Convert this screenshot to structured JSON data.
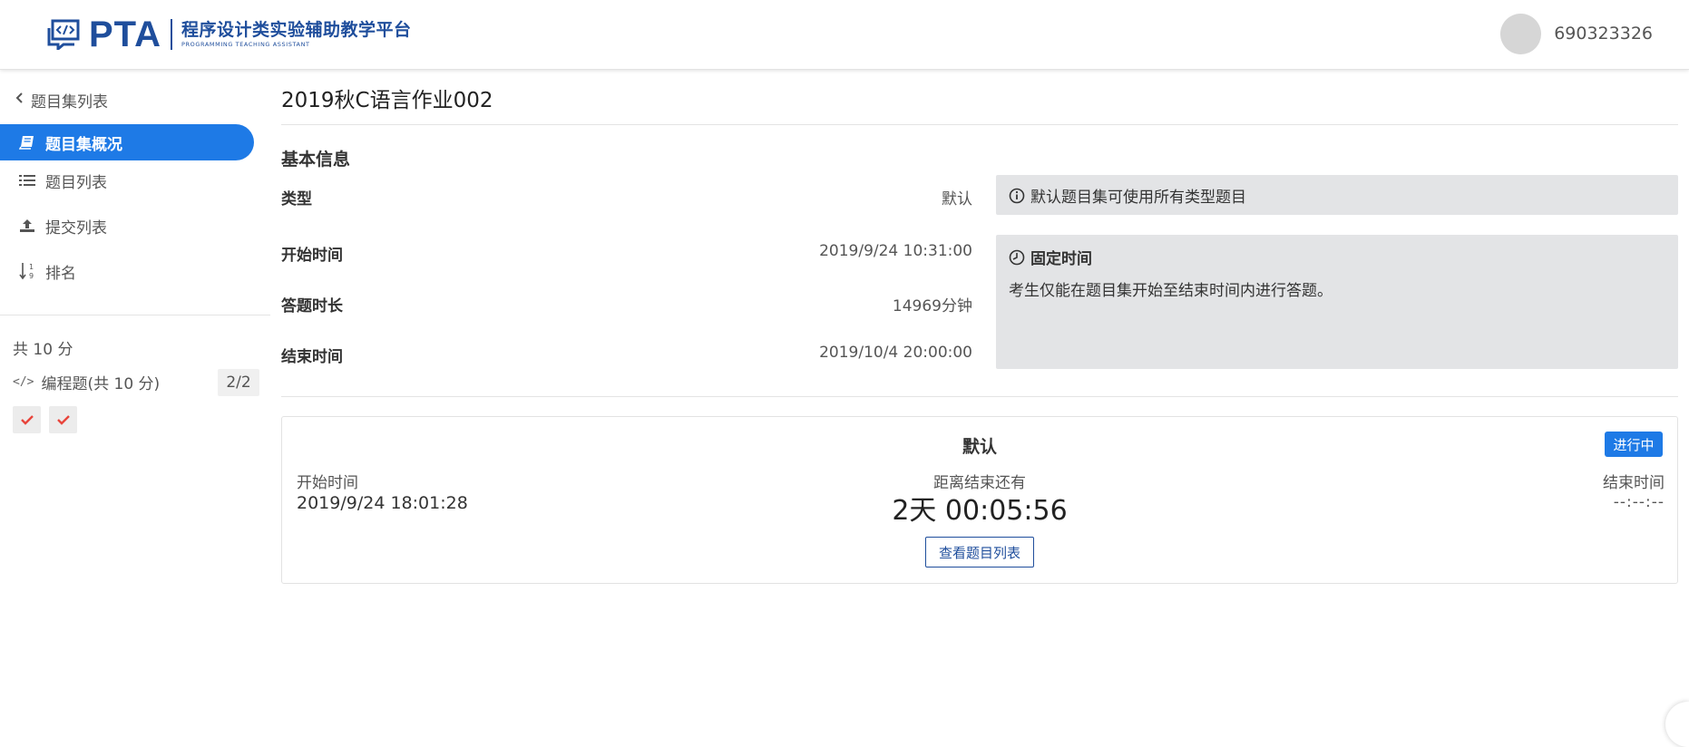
{
  "header": {
    "logo_mark": "PTA",
    "logo_title": "程序设计类实验辅助教学平台",
    "logo_subtitle": "PROGRAMMING TEACHING ASSISTANT",
    "username": "690323326"
  },
  "sidebar": {
    "back_label": "题目集列表",
    "items": [
      {
        "label": "题目集概况",
        "icon": "book-icon",
        "active": true
      },
      {
        "label": "题目列表",
        "icon": "list-icon",
        "active": false
      },
      {
        "label": "提交列表",
        "icon": "upload-icon",
        "active": false
      },
      {
        "label": "排名",
        "icon": "sort-numeric-icon",
        "active": false
      }
    ],
    "total_score": "共 10 分",
    "sections": [
      {
        "label": "编程题(共 10 分)",
        "count": "2/2",
        "icon": "code-icon"
      }
    ],
    "problem_status": [
      "check-icon",
      "check-icon"
    ],
    "accent": "#1e7ae6",
    "check_color": "#e8453c"
  },
  "main": {
    "title": "2019秋C语言作业002",
    "basic_info_title": "基本信息",
    "type_label": "类型",
    "type_value": "默认",
    "type_note": "默认题目集可使用所有类型题目",
    "start_label": "开始时间",
    "start_value": "2019/9/24 10:31:00",
    "duration_label": "答题时长",
    "duration_value": "14969分钟",
    "end_label": "结束时间",
    "end_value": "2019/10/4 20:00:00",
    "time_note_title": "固定时间",
    "time_note_text": "考生仅能在题目集开始至结束时间内进行答题。"
  },
  "exam": {
    "title": "默认",
    "status": "进行中",
    "start_label": "开始时间",
    "start_value": "2019/9/24 18:01:28",
    "remain_label": "距离结束还有",
    "remain_value": "2天 00:05:56",
    "end_label": "结束时间",
    "end_value": "--:--:--",
    "view_button": "查看题目列表"
  }
}
